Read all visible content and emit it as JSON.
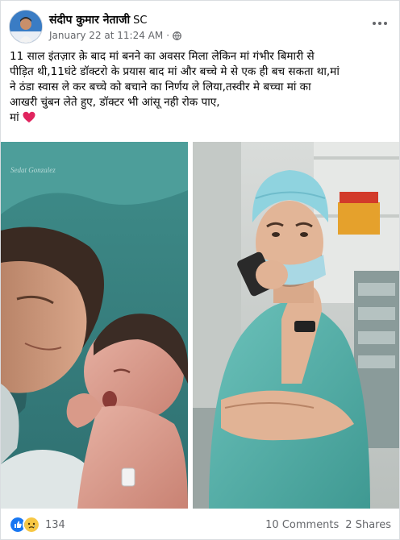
{
  "post": {
    "author": "संदीप कुमार नेताजी",
    "author_suffix": "SC",
    "timestamp": "January 22 at 11:24 AM",
    "separator": "·",
    "privacy_icon": "globe-icon",
    "caption_lines": [
      "11 साल इंतज़ार क़े बाद मां बनने का अवसर मिला लेकिन मां गंभीर बिमारी से",
      "पीड़ित थी,11घंटे डॉक्टरो के प्रयास बाद मां और बच्चे मे से एक ही बच सकता था,मां",
      "ने ठंडा स्वास ले कर बच्चे को बचाने का निर्णय ले लिया,तस्वीर मे बच्चा मां का",
      "आखरी चुंबन लेते हुए, डॉक्टर भी आंसू नही रोक पाए,",
      "मां"
    ],
    "caption_emoji": "red-heart-icon",
    "photo_watermark": "Sedat Gonzalez"
  },
  "footer": {
    "reaction_icons": [
      "like-icon",
      "sad-icon"
    ],
    "reaction_count": "134",
    "comments": "10 Comments",
    "shares": "2 Shares"
  },
  "colors": {
    "brand_blue": "#1877f2",
    "secondary_text": "#65676b",
    "heart_red": "#e0245e",
    "surgical_teal": "#5bb7b0"
  }
}
